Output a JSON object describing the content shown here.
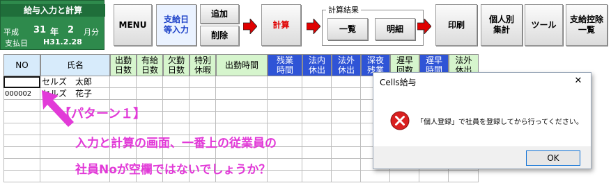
{
  "title_panel": {
    "title": "給与入力と計算",
    "era": "平成",
    "year": "31",
    "year_unit": "年",
    "month": "2",
    "month_unit": "月分",
    "paydate_label": "支払日",
    "paydate": "H31.2.28"
  },
  "toolbar": {
    "menu": "MENU",
    "pay_input": [
      "支給日",
      "等入力"
    ],
    "add": "追加",
    "delete": "削除",
    "calc": "計算",
    "calc_results_label": "計算結果",
    "list": "一覧",
    "detail": "明細",
    "print": "印刷",
    "individual": [
      "個人別",
      "集計"
    ],
    "tools": "ツール",
    "deduction": [
      "支給控除",
      "一覧"
    ]
  },
  "grid": {
    "headers": [
      {
        "text": [
          "NO"
        ],
        "style": "blue"
      },
      {
        "text": [
          "氏名"
        ],
        "style": "blue"
      },
      {
        "text": [
          "出勤",
          "日数"
        ],
        "style": "green"
      },
      {
        "text": [
          "有給",
          "日数"
        ],
        "style": "green"
      },
      {
        "text": [
          "欠勤",
          "日数"
        ],
        "style": "green"
      },
      {
        "text": [
          "特別",
          "休暇"
        ],
        "style": "green"
      },
      {
        "text": [
          "出勤時間"
        ],
        "style": "green"
      },
      {
        "text": [
          "残業",
          "時間"
        ],
        "style": "dark"
      },
      {
        "text": [
          "法内",
          "休出"
        ],
        "style": "dark"
      },
      {
        "text": [
          "法外",
          "休出"
        ],
        "style": "dark"
      },
      {
        "text": [
          "深夜",
          "残業"
        ],
        "style": "dark"
      },
      {
        "text": [
          "遅早",
          "回数"
        ],
        "style": "green"
      },
      {
        "text": [
          "遅早",
          "時間"
        ],
        "style": "dark"
      },
      {
        "text": [
          "法外",
          "休出"
        ],
        "style": "green"
      }
    ],
    "rows": [
      {
        "no": "",
        "name": "セルズ　太郎"
      },
      {
        "no": "000002",
        "name": "セルズ　花子"
      }
    ]
  },
  "annotation": {
    "pattern": "【パターン１】",
    "line1": "入力と計算の画面、一番上の従業員の",
    "line2": "社員Noが空欄ではないでしょうか？",
    "color": "#e23ad8"
  },
  "dialog": {
    "title": "Cells給与",
    "message": "「個人登録」で社員を登録してから行ってください。",
    "ok": "OK",
    "close_glyph": "✕"
  },
  "colors": {
    "title_green": "#2e8a4c",
    "header_blue": "#d7ebfb",
    "header_green": "#d6f5cd",
    "header_dark": "#2f54d6",
    "arrow_red": "#e00000"
  }
}
